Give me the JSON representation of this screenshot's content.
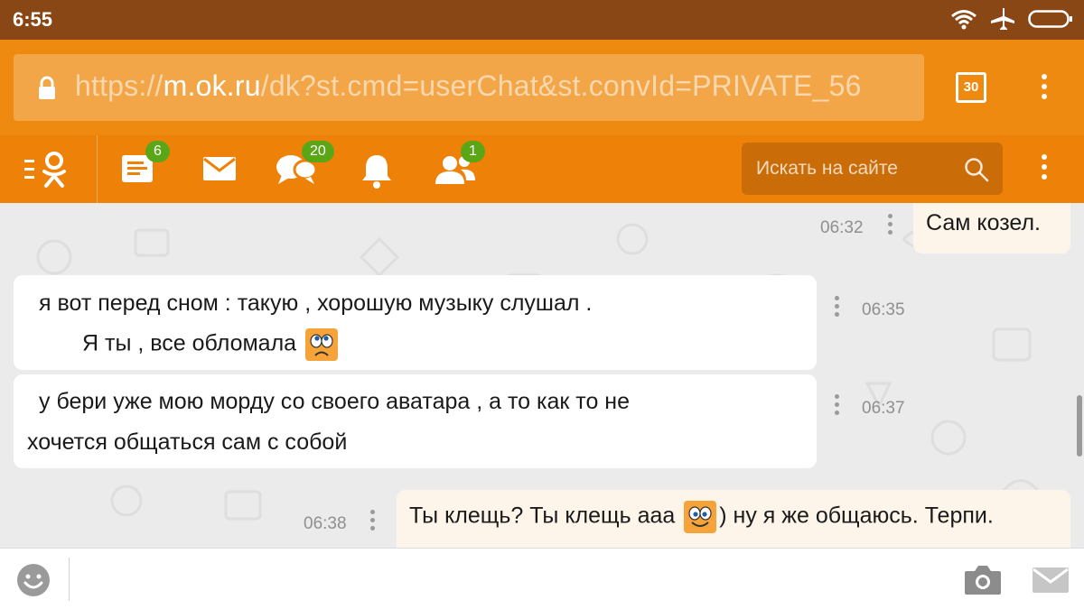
{
  "status_bar": {
    "time": "6:55",
    "icons": [
      "wifi-icon",
      "airplane-icon",
      "battery-icon"
    ]
  },
  "browser": {
    "url_prefix": "https://",
    "url_host": "m.ok.ru",
    "url_path": "/dk?st.cmd=userChat&st.convId=PRIVATE_56",
    "tabs_count": "30"
  },
  "nav": {
    "items": [
      {
        "icon": "feed-icon",
        "badge": "6"
      },
      {
        "icon": "mail-icon",
        "badge": ""
      },
      {
        "icon": "discussions-icon",
        "badge": "20"
      },
      {
        "icon": "bell-icon",
        "badge": ""
      },
      {
        "icon": "friends-icon",
        "badge": "1"
      }
    ],
    "search_placeholder": "Искать на сайте"
  },
  "messages": [
    {
      "direction": "out",
      "time": "06:32",
      "lines": [
        "Сам козел."
      ]
    },
    {
      "direction": "in",
      "time": "06:35",
      "lines": [
        "я  вот перед сном  :  такую  ,  хорошую  музыку  слушал .",
        "Я  ты ,  все  обломала"
      ],
      "emoji": "sad-emoji-icon"
    },
    {
      "direction": "in",
      "time": "06:37",
      "lines": [
        "у  бери  уже  мою  морду  со  своего  аватара ,  а  то  как то  не",
        "хочется  общаться  сам  с  собой"
      ]
    },
    {
      "direction": "out",
      "time": "06:38",
      "lines": [
        "Ты клещь? Ты клещь ааа",
        ") ну я же общаюсь. Терпи."
      ],
      "emoji": "smile-emoji-icon"
    }
  ],
  "composer": {
    "placeholder": "",
    "icons": [
      "emoji-icon",
      "camera-icon",
      "send-mail-icon"
    ]
  },
  "colors": {
    "status_bar": "#8a4716",
    "url_bar": "#ee8a10",
    "ok_bar": "#ee8208",
    "badge": "#5ba616",
    "chat_bg": "#ebebeb",
    "outgoing_bubble": "#fdf5ea"
  }
}
